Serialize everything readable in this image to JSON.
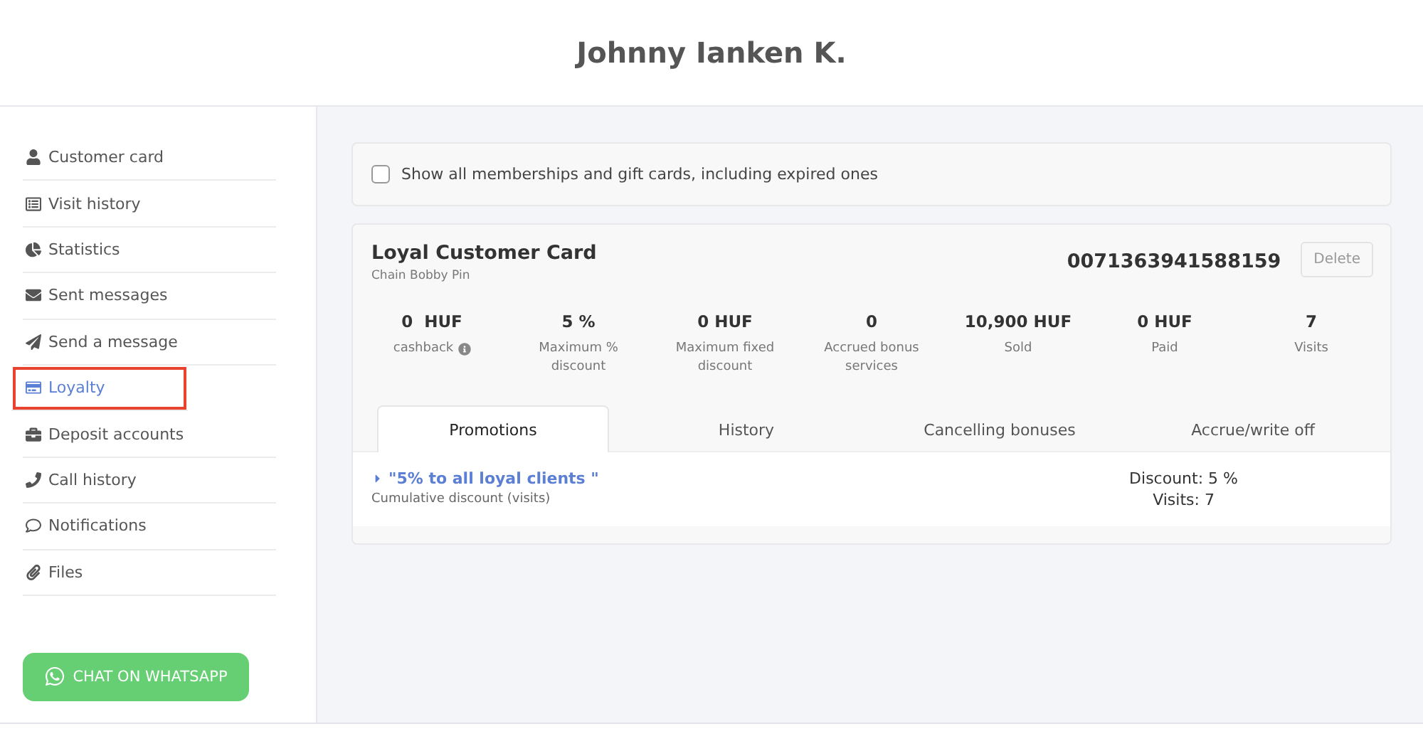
{
  "header": {
    "title": "Johnny Ianken K."
  },
  "sidebar": {
    "items": [
      {
        "label": "Customer card",
        "selected": false,
        "highlighted": false
      },
      {
        "label": "Visit history",
        "selected": false,
        "highlighted": false
      },
      {
        "label": "Statistics",
        "selected": false,
        "highlighted": false
      },
      {
        "label": "Sent messages",
        "selected": false,
        "highlighted": false
      },
      {
        "label": "Send a message",
        "selected": false,
        "highlighted": false
      },
      {
        "label": "Loyalty",
        "selected": true,
        "highlighted": true
      },
      {
        "label": "Deposit accounts",
        "selected": false,
        "highlighted": false
      },
      {
        "label": "Call history",
        "selected": false,
        "highlighted": false
      },
      {
        "label": "Notifications",
        "selected": false,
        "highlighted": false
      },
      {
        "label": "Files",
        "selected": false,
        "highlighted": false
      }
    ],
    "whatsapp_button": "CHAT ON WHATSAPP"
  },
  "filter": {
    "label": "Show all memberships and gift cards, including expired ones",
    "checked": false
  },
  "card": {
    "title": "Loyal Customer Card",
    "subtitle": "Chain Bobby Pin",
    "number": "0071363941588159",
    "delete_button": "Delete",
    "stats": [
      {
        "value": "0  HUF",
        "label": "cashback",
        "info": true
      },
      {
        "value": "5 %",
        "label": "Maximum % discount",
        "info": false
      },
      {
        "value": "0 HUF",
        "label": "Maximum fixed discount",
        "info": false
      },
      {
        "value": "0",
        "label": "Accrued bonus services",
        "info": false
      },
      {
        "value": "10,900 HUF",
        "label": "Sold",
        "info": false
      },
      {
        "value": "0 HUF",
        "label": "Paid",
        "info": false
      },
      {
        "value": "7",
        "label": "Visits",
        "info": false
      }
    ],
    "tabs": [
      {
        "label": "Promotions",
        "selected": true
      },
      {
        "label": "History",
        "selected": false
      },
      {
        "label": "Cancelling bonuses",
        "selected": false
      },
      {
        "label": "Accrue/write off",
        "selected": false
      }
    ],
    "promotions": [
      {
        "name": "\"5% to all loyal clients \"",
        "type": "Cumulative discount (visits)",
        "discount": "Discount: 5 %",
        "visits": "Visits: 7"
      }
    ]
  }
}
